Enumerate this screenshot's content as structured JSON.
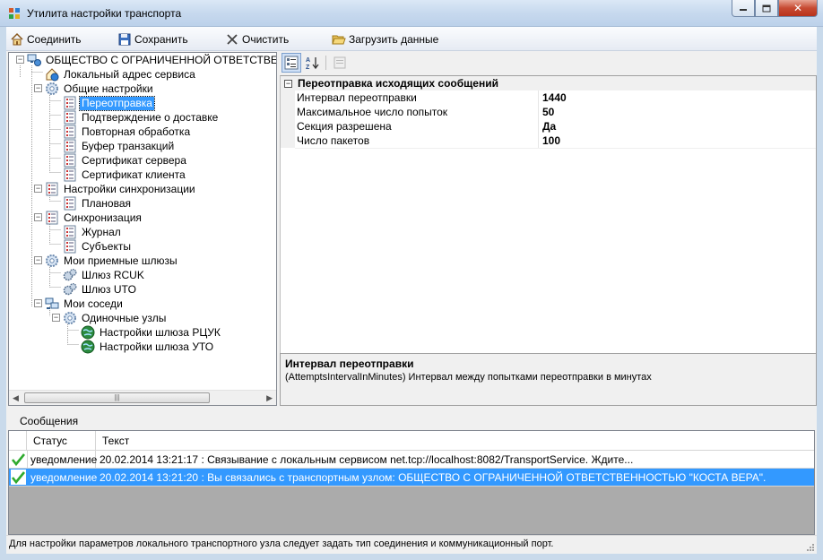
{
  "window": {
    "title": "Утилита настройки транспорта",
    "controls": [
      "minimize",
      "maximize",
      "close"
    ]
  },
  "toolbar": {
    "connect": {
      "label": "Соединить",
      "icon": "home-icon"
    },
    "save": {
      "label": "Сохранить",
      "icon": "floppy-disk-icon"
    },
    "clear": {
      "label": "Очистить",
      "icon": "x-icon"
    },
    "load": {
      "label": "Загрузить данные",
      "icon": "open-folder-icon"
    }
  },
  "tree": {
    "root": "ОБЩЕСТВО С ОГРАНИЧЕННОЙ ОТВЕТСТВЕННО",
    "local_service": "Локальный адрес сервиса",
    "general": "Общие настройки",
    "general_items": [
      "Переотправка",
      "Подтверждение о доставке",
      "Повторная обработка",
      "Буфер транзакций",
      "Сертификат сервера",
      "Сертификат клиента"
    ],
    "sync_settings": "Настройки синхронизации",
    "sync_settings_items": [
      "Плановая"
    ],
    "sync": "Синхронизация",
    "sync_items": [
      "Журнал",
      "Субъекты"
    ],
    "gateways": "Мои приемные шлюзы",
    "gateway_items": [
      "Шлюз RCUK",
      "Шлюз UTO"
    ],
    "neighbors": "Мои соседи",
    "single_nodes": "Одиночные узлы",
    "single_node_items": [
      "Настройки шлюза РЦУК",
      "Настройки шлюза УТО"
    ],
    "selected": "Переотправка"
  },
  "property_grid": {
    "category": "Переотправка исходящих сообщений",
    "rows": [
      {
        "name": "Интервал переотправки",
        "value": "1440"
      },
      {
        "name": "Максимальное число попыток",
        "value": "50"
      },
      {
        "name": "Секция разрешена",
        "value": "Да"
      },
      {
        "name": "Число пакетов",
        "value": "100"
      }
    ],
    "help_title": "Интервал переотправки",
    "help_desc": "(AttemptsIntervalInMinutes) Интервал между попытками переотправки в минутах"
  },
  "messages": {
    "title": "Сообщения",
    "columns": [
      "Статус",
      "Текст"
    ],
    "rows": [
      {
        "status": "уведомление",
        "text": "20.02.2014 13:21:17 : Связывание с локальным сервисом net.tcp://localhost:8082/TransportService. Ждите...",
        "selected": false
      },
      {
        "status": "уведомление",
        "text": "20.02.2014 13:21:20 : Вы связались с транспортным узлом: ОБЩЕСТВО С ОГРАНИЧЕННОЙ ОТВЕТСТВЕННОСТЬЮ \"КОСТА ВЕРА\".",
        "selected": true
      }
    ]
  },
  "status_bar": {
    "text": "Для настройки параметров локального транспортного узла следует задать тип соединения и коммуникационный порт."
  },
  "colors": {
    "selection": "#3399ff",
    "window_bg": "#f0f0f0",
    "title_bar": "#c7d9ee",
    "close_button": "#c74a32",
    "check_green": "#2eaa2e"
  }
}
